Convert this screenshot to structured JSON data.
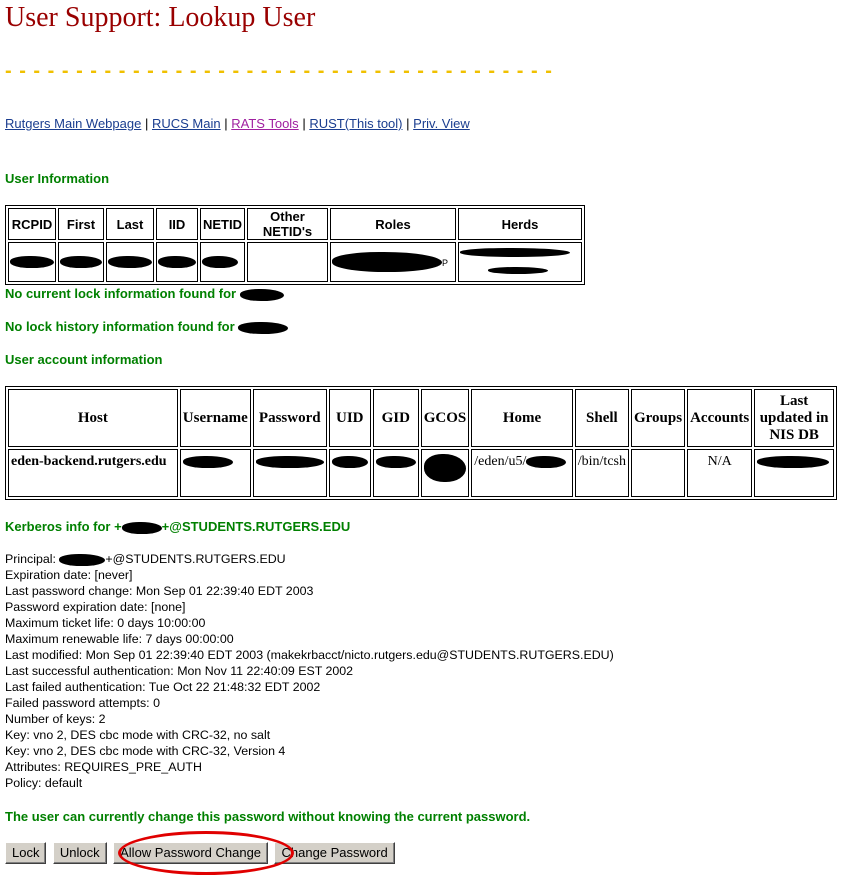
{
  "page": {
    "title": "User Support: Lookup User",
    "divider": "- - - - - - - - - - - - - - - - - - - - - - - - - - - - - - - - - - - - - - -"
  },
  "nav": {
    "links": [
      "Rutgers Main Webpage",
      "RUCS Main",
      "RATS Tools",
      "RUST(This tool)",
      "Priv. View"
    ],
    "separator": "|"
  },
  "user_information": {
    "heading": "User Information",
    "columns": [
      "RCPID",
      "First",
      "Last",
      "IID",
      "NETID",
      "Other NETID's",
      "Roles",
      "Herds"
    ],
    "herds_suffix": "",
    "roles_suffix": "P"
  },
  "lock": {
    "current": "No current lock information found for",
    "history": "No lock history information found for"
  },
  "account_info": {
    "heading": "User account information",
    "columns": [
      "Host",
      "Username",
      "Password",
      "UID",
      "GID",
      "GCOS",
      "Home",
      "Shell",
      "Groups",
      "Accounts",
      "Last updated in NIS DB"
    ],
    "row": {
      "host": "eden-backend.rutgers.edu",
      "home_prefix": "/eden/u5/",
      "shell": "/bin/tcsh",
      "accounts": "N/A"
    }
  },
  "kerberos": {
    "heading_prefix": "Kerberos info for +",
    "heading_suffix": "+@STUDENTS.RUTGERS.EDU",
    "principal_label": "Principal: ",
    "principal_suffix": "+@STUDENTS.RUTGERS.EDU",
    "lines": [
      "Expiration date: [never]",
      "Last password change: Mon Sep 01 22:39:40 EDT 2003",
      "Password expiration date: [none]",
      "Maximum ticket life: 0 days 10:00:00",
      "Maximum renewable life: 7 days 00:00:00",
      "Last modified: Mon Sep 01 22:39:40 EDT 2003 (makekrbacct/nicto.rutgers.edu@STUDENTS.RUTGERS.EDU)",
      "Last successful authentication: Mon Nov 11 22:40:09 EST 2002",
      "Last failed authentication: Tue Oct 22 21:48:32 EDT 2002",
      "Failed password attempts: 0",
      "Number of keys: 2",
      "Key: vno 2, DES cbc mode with CRC-32, no salt",
      "Key: vno 2, DES cbc mode with CRC-32, Version 4",
      "Attributes: REQUIRES_PRE_AUTH",
      "Policy: default"
    ]
  },
  "password_note": "The user can currently change this password without knowing the current password.",
  "buttons": [
    "Lock",
    "Unlock",
    "Allow Password Change",
    "Change Password"
  ],
  "colors": {
    "title": "#990000",
    "section": "#008000",
    "divider": "#f0c000",
    "link": "#1a3d8f",
    "visited_link": "#a020a0",
    "annotation": "#e00000"
  }
}
